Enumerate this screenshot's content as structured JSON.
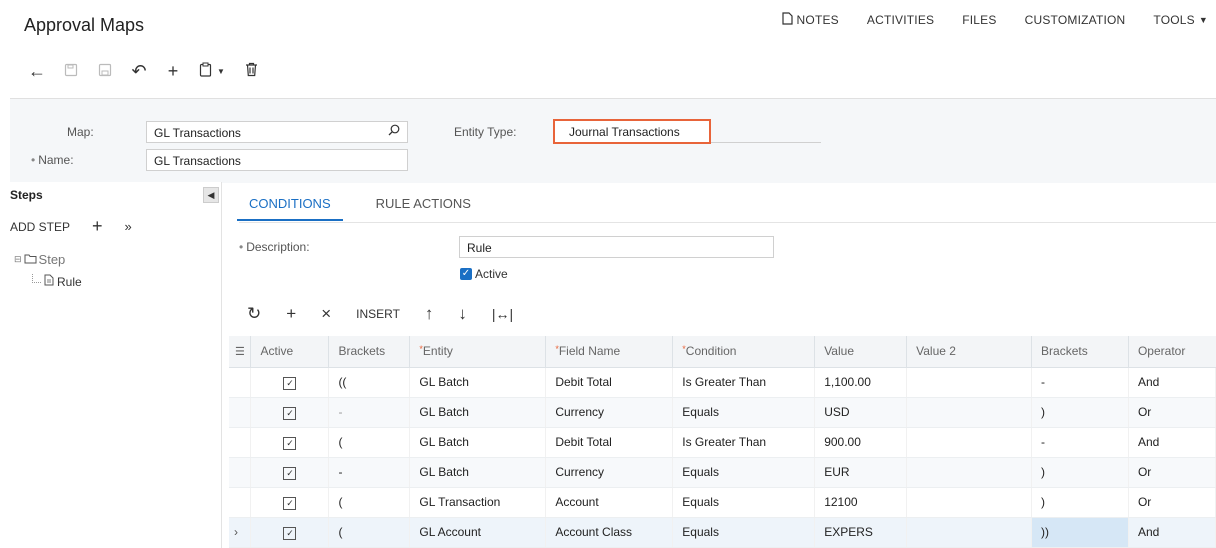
{
  "page": {
    "title": "Approval Maps"
  },
  "topnav": {
    "notes": "NOTES",
    "activities": "ACTIVITIES",
    "files": "FILES",
    "customization": "CUSTOMIZATION",
    "tools": "TOOLS"
  },
  "header": {
    "map_label": "Map:",
    "map_value": "GL Transactions",
    "name_label": "Name:",
    "name_value": "GL Transactions",
    "entity_type_label": "Entity Type:",
    "entity_type_value": "Journal Transactions"
  },
  "steps": {
    "title": "Steps",
    "add_step": "ADD STEP",
    "tree": {
      "step": "Step",
      "rule": "Rule"
    }
  },
  "tabs": {
    "conditions": "CONDITIONS",
    "rule_actions": "RULE ACTIONS"
  },
  "rule": {
    "description_label": "Description:",
    "description_value": "Rule",
    "active_label": "Active"
  },
  "grid_toolbar": {
    "insert": "INSERT"
  },
  "grid": {
    "columns": {
      "active": "Active",
      "brackets_open": "Brackets",
      "entity": "Entity",
      "field_name": "Field Name",
      "condition": "Condition",
      "value": "Value",
      "value2": "Value 2",
      "brackets_close": "Brackets",
      "operator": "Operator"
    },
    "rows": [
      {
        "open": "((",
        "entity": "GL Batch",
        "field": "Debit Total",
        "condition": "Is Greater Than",
        "value": "1,100.00",
        "value2": "",
        "close": "-",
        "operator": "And"
      },
      {
        "open": "-",
        "entity": "GL Batch",
        "field": "Currency",
        "condition": "Equals",
        "value": "USD",
        "value2": "",
        "close": ")",
        "operator": "Or"
      },
      {
        "open": "(",
        "entity": "GL Batch",
        "field": "Debit Total",
        "condition": "Is Greater Than",
        "value": "900.00",
        "value2": "",
        "close": "-",
        "operator": "And"
      },
      {
        "open": "-",
        "entity": "GL Batch",
        "field": "Currency",
        "condition": "Equals",
        "value": "EUR",
        "value2": "",
        "close": ")",
        "operator": "Or"
      },
      {
        "open": "(",
        "entity": "GL Transaction",
        "field": "Account",
        "condition": "Equals",
        "value": "12100",
        "value2": "",
        "close": ")",
        "operator": "Or"
      },
      {
        "open": "(",
        "entity": "GL Account",
        "field": "Account Class",
        "condition": "Equals",
        "value": "EXPERS",
        "value2": "",
        "close": "))",
        "operator": "And"
      }
    ]
  }
}
